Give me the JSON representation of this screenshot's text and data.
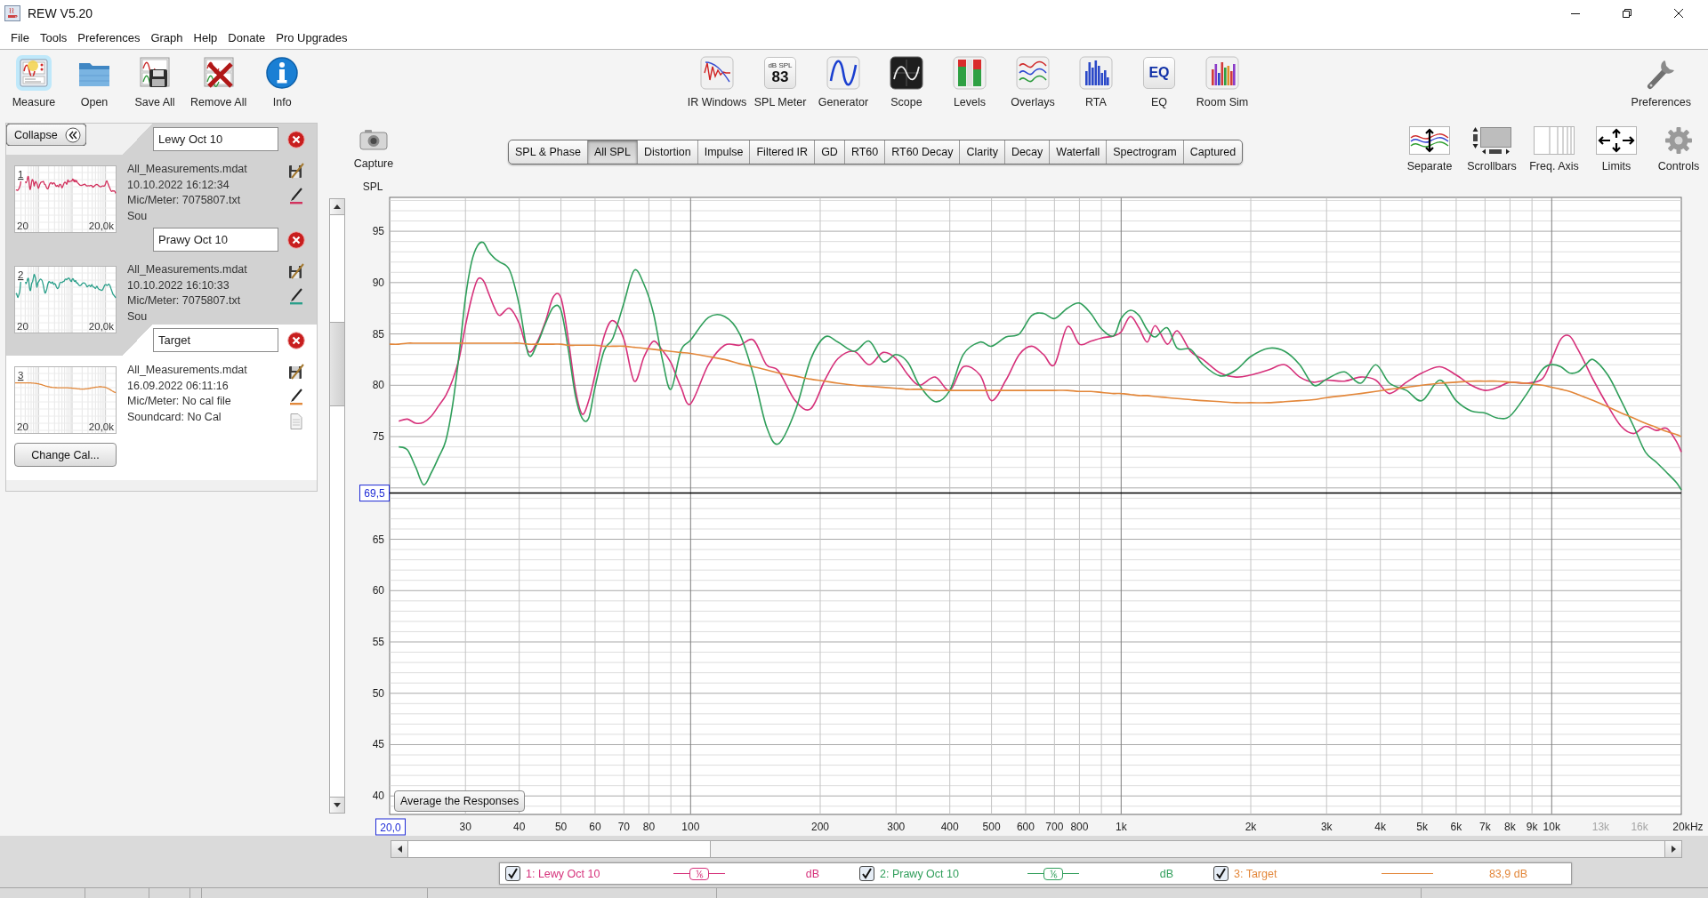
{
  "window": {
    "title": "REW V5.20"
  },
  "menu": [
    "File",
    "Tools",
    "Preferences",
    "Graph",
    "Help",
    "Donate",
    "Pro Upgrades"
  ],
  "toolbar": {
    "left": [
      {
        "label": "Measure",
        "kind": "measure",
        "highlighted": true
      },
      {
        "label": "Open",
        "kind": "open",
        "highlighted": false
      },
      {
        "label": "Save All",
        "kind": "save",
        "highlighted": false
      },
      {
        "label": "Remove All",
        "kind": "remove",
        "highlighted": false
      },
      {
        "label": "Info",
        "kind": "info",
        "highlighted": false
      }
    ],
    "middle": [
      {
        "label": "IR Windows",
        "kind": "irwindows"
      },
      {
        "label": "SPL Meter",
        "kind": "meter",
        "display": [
          "dB SPL",
          "83"
        ]
      },
      {
        "label": "Generator",
        "kind": "generator"
      },
      {
        "label": "Scope",
        "kind": "scope"
      },
      {
        "label": "Levels",
        "kind": "levels"
      },
      {
        "label": "Overlays",
        "kind": "overlays"
      },
      {
        "label": "RTA",
        "kind": "rta"
      },
      {
        "label": "EQ",
        "kind": "eq",
        "display": [
          "EQ"
        ]
      },
      {
        "label": "Room Sim",
        "kind": "roomsim"
      }
    ],
    "right": [
      {
        "label": "Preferences",
        "kind": "wrench"
      }
    ]
  },
  "measurements": {
    "collapse": "Collapse",
    "cards": [
      {
        "number": "1",
        "name": "Lewy Oct 10",
        "selected": false,
        "color": "#d2325e",
        "axis_start": "20",
        "axis_end": "20,0k",
        "file": "All_Measurements.mdat",
        "date": "10.10.2022 16:12:34",
        "mic": "Mic/Meter: 7075807.txt",
        "soundcard": "Sou"
      },
      {
        "number": "2",
        "name": "Prawy Oct 10",
        "selected": false,
        "color": "#2a9f8a",
        "axis_start": "20",
        "axis_end": "20,0k",
        "file": "All_Measurements.mdat",
        "date": "10.10.2022 16:10:33",
        "mic": "Mic/Meter: 7075807.txt",
        "soundcard": "Sou"
      },
      {
        "number": "3",
        "name": "Target",
        "selected": true,
        "color": "#e2893c",
        "axis_start": "20",
        "axis_end": "20,0k",
        "file": "All_Measurements.mdat",
        "date": "16.09.2022 06:11:16",
        "mic": "Mic/Meter: No cal file",
        "soundcard": "Soundcard: No Cal",
        "button": "Change Cal..."
      }
    ]
  },
  "graph": {
    "capture": "Capture",
    "tabs": [
      {
        "label": "SPL & Phase",
        "selected": false
      },
      {
        "label": "All SPL",
        "selected": true
      },
      {
        "label": "Distortion",
        "selected": false
      },
      {
        "label": "Impulse",
        "selected": false
      },
      {
        "label": "Filtered IR",
        "selected": false
      },
      {
        "label": "GD",
        "selected": false
      },
      {
        "label": "RT60",
        "selected": false
      },
      {
        "label": "RT60 Decay",
        "selected": false
      },
      {
        "label": "Clarity",
        "selected": false
      },
      {
        "label": "Decay",
        "selected": false
      },
      {
        "label": "Waterfall",
        "selected": false
      },
      {
        "label": "Spectrogram",
        "selected": false
      },
      {
        "label": "Captured",
        "selected": false
      }
    ],
    "tools": [
      {
        "label": "Separate",
        "kind": "separate"
      },
      {
        "label": "Scrollbars",
        "kind": "scrollbars"
      },
      {
        "label": "Freq. Axis",
        "kind": "axis"
      },
      {
        "label": "Limits",
        "kind": "limits"
      },
      {
        "label": "Controls",
        "kind": "controls"
      }
    ],
    "chart_data": {
      "type": "line",
      "xlabel": "Hz",
      "ylabel": "SPL",
      "log": "x",
      "grid": true,
      "x": [
        20,
        21,
        22,
        23,
        24,
        25,
        26,
        27,
        28,
        29,
        30,
        31,
        32,
        33,
        34,
        35,
        36,
        38,
        40,
        42,
        44,
        46,
        48,
        50,
        52,
        54,
        56,
        58,
        60,
        63,
        66,
        70,
        74,
        78,
        82,
        86,
        90,
        95,
        100,
        110,
        120,
        130,
        140,
        150,
        160,
        175,
        190,
        205,
        220,
        240,
        260,
        280,
        300,
        320,
        340,
        370,
        400,
        430,
        470,
        500,
        540,
        580,
        620,
        660,
        700,
        750,
        800,
        850,
        900,
        960,
        1000,
        1050,
        1100,
        1150,
        1200,
        1280,
        1350,
        1450,
        1550,
        1700,
        1850,
        2000,
        2200,
        2400,
        2600,
        2800,
        3000,
        3300,
        3600,
        3900,
        4200,
        4600,
        5000,
        5500,
        6000,
        6500,
        7000,
        7500,
        8000,
        8700,
        9500,
        10000,
        10500,
        11000,
        11500,
        12000,
        12500,
        13500,
        14500,
        15500,
        16500,
        17500,
        18500,
        19500,
        20000
      ],
      "series": [
        {
          "name": "1: Lewy Oct 10",
          "color": "#d6307a",
          "values": [
            null,
            76.5,
            76.7,
            76.3,
            76.4,
            77.0,
            78.0,
            79.0,
            80.5,
            82.6,
            85.8,
            88.5,
            90.3,
            90.2,
            88.9,
            87.6,
            86.8,
            87.5,
            86.0,
            83.3,
            84.2,
            86.2,
            88.6,
            88.5,
            84.5,
            79.6,
            77.2,
            78.5,
            81.0,
            84.8,
            86.3,
            84.5,
            80.4,
            82.8,
            84.3,
            83.4,
            82.2,
            79.8,
            78.2,
            82.0,
            83.9,
            83.9,
            84.4,
            82.0,
            81.4,
            78.5,
            77.7,
            80.5,
            82.6,
            83.3,
            82.0,
            83.2,
            82.6,
            81.0,
            80.0,
            80.8,
            79.5,
            81.8,
            81.0,
            78.5,
            80.5,
            83.0,
            83.8,
            83.0,
            82.0,
            85.7,
            84.0,
            84.3,
            84.6,
            84.8,
            85.2,
            86.7,
            85.6,
            84.2,
            85.8,
            84.0,
            85.3,
            83.3,
            82.5,
            81.2,
            80.8,
            81.0,
            81.5,
            82.0,
            80.8,
            80.3,
            80.5,
            80.4,
            80.8,
            80.5,
            79.2,
            80.3,
            81.2,
            81.8,
            81.0,
            80.0,
            79.5,
            79.8,
            80.3,
            80.2,
            80.6,
            82.5,
            84.5,
            84.8,
            83.5,
            82.0,
            80.5,
            78.0,
            76.0,
            75.3,
            76.0,
            75.6,
            75.8,
            74.5,
            73.5
          ]
        },
        {
          "name": "2: Prawy Oct 10",
          "color": "#2f9e5a",
          "values": [
            null,
            74.0,
            73.7,
            72.0,
            70.3,
            71.5,
            73.0,
            74.6,
            78.0,
            83.0,
            88.5,
            92.0,
            93.6,
            93.9,
            93.0,
            92.4,
            92.0,
            91.2,
            87.8,
            83.0,
            84.0,
            86.0,
            87.6,
            87.3,
            83.5,
            79.0,
            76.8,
            76.8,
            79.8,
            83.4,
            84.6,
            88.0,
            91.2,
            89.8,
            87.0,
            82.5,
            79.6,
            83.4,
            84.4,
            86.6,
            86.7,
            85.0,
            81.0,
            76.0,
            74.3,
            77.5,
            82.5,
            84.7,
            84.2,
            83.3,
            84.3,
            82.3,
            83.0,
            82.2,
            80.0,
            78.4,
            79.5,
            83.0,
            84.2,
            83.8,
            84.7,
            85.0,
            86.8,
            87.0,
            86.5,
            87.5,
            88.0,
            87.0,
            85.5,
            84.8,
            86.5,
            87.3,
            86.8,
            85.4,
            84.7,
            85.6,
            83.6,
            83.5,
            82.0,
            80.9,
            81.5,
            82.8,
            83.6,
            83.3,
            82.0,
            80.0,
            80.6,
            81.3,
            80.2,
            82.0,
            80.2,
            79.5,
            78.5,
            80.5,
            78.5,
            77.5,
            77.3,
            76.8,
            77.0,
            79.0,
            81.5,
            82.0,
            81.8,
            81.2,
            81.3,
            82.0,
            82.5,
            81.0,
            78.5,
            76.0,
            73.5,
            72.5,
            71.5,
            70.5,
            69.8
          ]
        },
        {
          "name": "3: Target",
          "color": "#e3873a",
          "values": [
            84.0,
            84.0,
            84.1,
            84.1,
            84.1,
            84.1,
            84.1,
            84.1,
            84.1,
            84.1,
            84.1,
            84.1,
            84.1,
            84.1,
            84.1,
            84.1,
            84.1,
            84.1,
            84.1,
            84.0,
            84.0,
            84.0,
            84.0,
            84.0,
            83.9,
            83.9,
            83.9,
            83.9,
            83.9,
            83.8,
            83.8,
            83.8,
            83.7,
            83.6,
            83.5,
            83.4,
            83.3,
            83.2,
            83.1,
            82.8,
            82.5,
            82.1,
            81.8,
            81.5,
            81.2,
            80.9,
            80.6,
            80.4,
            80.2,
            80.0,
            79.9,
            79.8,
            79.7,
            79.6,
            79.6,
            79.5,
            79.5,
            79.5,
            79.5,
            79.5,
            79.5,
            79.5,
            79.5,
            79.5,
            79.5,
            79.5,
            79.4,
            79.4,
            79.3,
            79.2,
            79.2,
            79.1,
            79.0,
            79.0,
            78.9,
            78.8,
            78.7,
            78.6,
            78.5,
            78.4,
            78.3,
            78.3,
            78.3,
            78.4,
            78.5,
            78.6,
            78.8,
            79.0,
            79.2,
            79.4,
            79.6,
            79.8,
            80.0,
            80.2,
            80.3,
            80.4,
            80.4,
            80.4,
            80.3,
            80.2,
            80.0,
            79.8,
            79.6,
            79.4,
            79.1,
            78.8,
            78.5,
            77.9,
            77.3,
            76.8,
            76.3,
            75.9,
            75.5,
            75.2,
            75.0
          ]
        }
      ],
      "xlim": [
        20,
        20000
      ],
      "ylim": [
        38.2,
        98.3
      ],
      "xticks": [
        30,
        40,
        50,
        60,
        70,
        80,
        100,
        200,
        300,
        400,
        500,
        600,
        700,
        800,
        {
          "value": 1000,
          "label": "1k"
        },
        {
          "value": 2000,
          "label": "2k"
        },
        {
          "value": 3000,
          "label": "3k"
        },
        {
          "value": 4000,
          "label": "4k"
        },
        {
          "value": 5000,
          "label": "5k"
        },
        {
          "value": 6000,
          "label": "6k"
        },
        {
          "value": 7000,
          "label": "7k"
        },
        {
          "value": 8000,
          "label": "8k"
        },
        {
          "value": 9000,
          "label": "9k"
        },
        {
          "value": 10000,
          "label": "10k"
        },
        {
          "value": 13000,
          "label": "13k"
        },
        {
          "value": 16000,
          "label": "16k"
        },
        {
          "value": 20000,
          "label": "20k"
        }
      ],
      "yticks": [
        40,
        45,
        50,
        55,
        60,
        65,
        75,
        80,
        85,
        90,
        95
      ],
      "ref_lines": [
        {
          "axis": "y",
          "value": 69.5,
          "label": "69,5"
        }
      ],
      "annotations": [
        "20,0"
      ]
    },
    "average_button": "Average the Responses",
    "legend": [
      {
        "checked": true,
        "smoothing": "⅙",
        "reading": "dB"
      },
      {
        "checked": true,
        "smoothing": "⅙",
        "reading": "dB"
      },
      {
        "checked": true,
        "reading": "83,9 dB"
      }
    ]
  }
}
